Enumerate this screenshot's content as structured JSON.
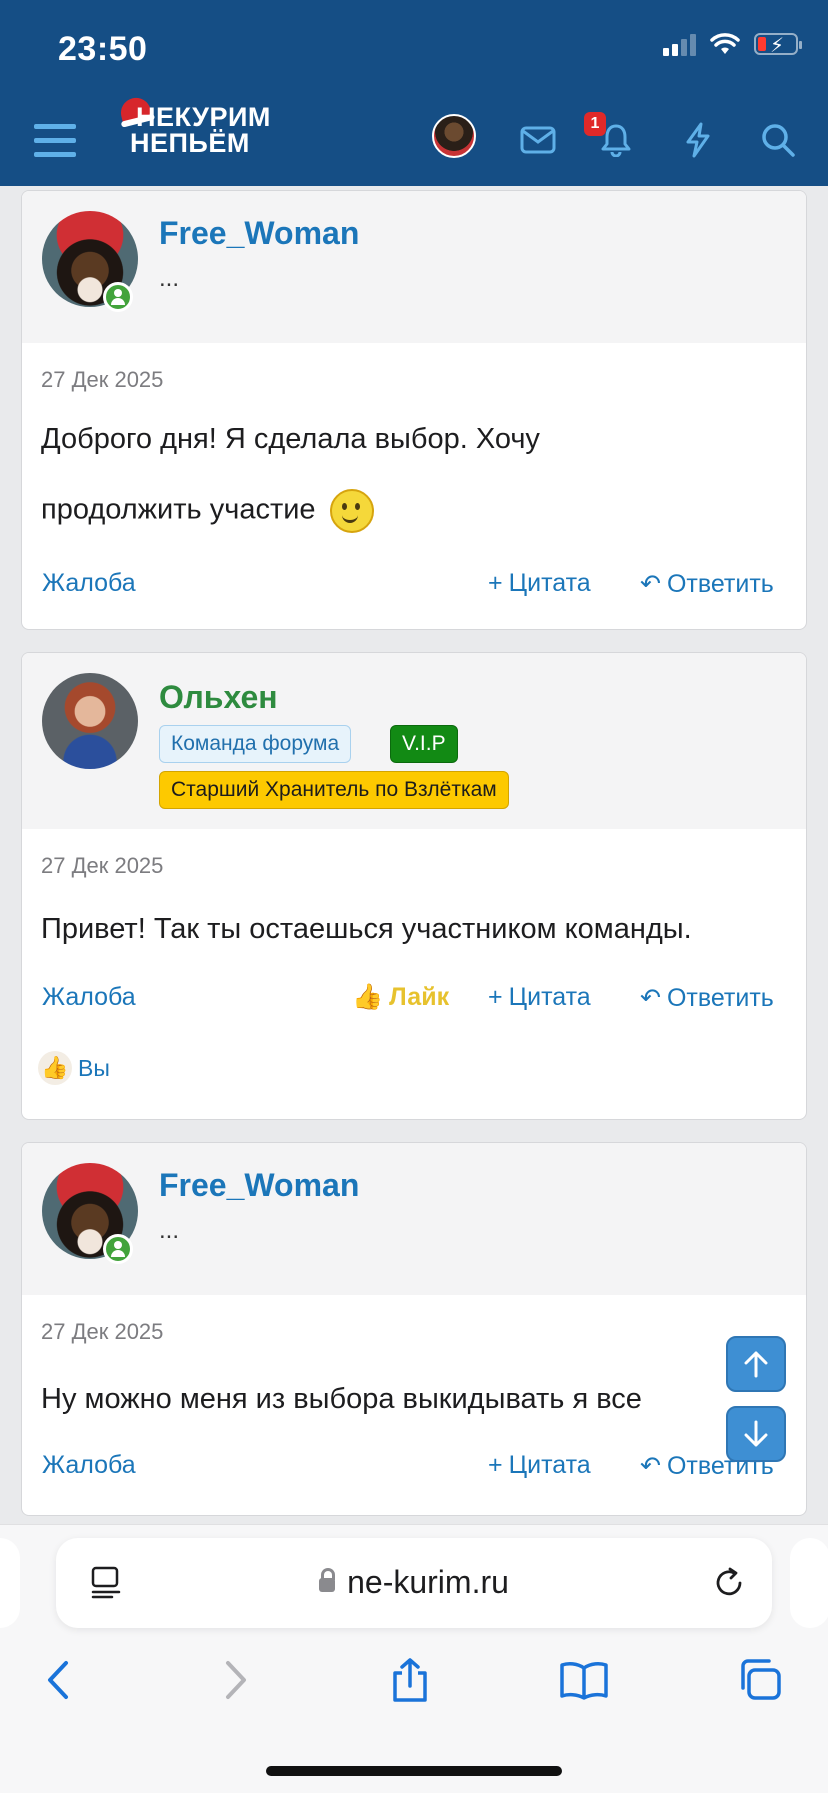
{
  "status_bar": {
    "time": "23:50"
  },
  "header": {
    "logo_line1": "НЕКУРИМ",
    "logo_line2": "НЕПЬЁМ",
    "notification_count": "1",
    "colors": {
      "bar": "#154e85",
      "accent": "#5fb0e8"
    }
  },
  "posts": [
    {
      "author": "Free_Woman",
      "subtitle": "...",
      "date": "27 Дек 2025",
      "text_line1": "Доброго дня! Я сделала выбор. Хочу",
      "text_line2": "продолжить участие",
      "actions": {
        "report": "Жалоба",
        "quote": "Цитата",
        "reply": "Ответить"
      }
    },
    {
      "author": "Ольхен",
      "badges": {
        "team": "Команда форума",
        "vip": "V.I.P",
        "title": "Старший Хранитель по Взлёткам"
      },
      "date": "27 Дек 2025",
      "text": "Привет! Так ты остаешься участником команды.",
      "actions": {
        "report": "Жалоба",
        "like": "Лайк",
        "quote": "Цитата",
        "reply": "Ответить"
      },
      "reactions_by": "Вы"
    },
    {
      "author": "Free_Woman",
      "subtitle": "...",
      "date": "27 Дек 2025",
      "text": "Ну можно меня из выбора выкидывать я все",
      "actions": {
        "report": "Жалоба",
        "quote": "Цитата",
        "reply": "Ответить"
      }
    }
  ],
  "browser": {
    "url": "ne-kurim.ru"
  }
}
